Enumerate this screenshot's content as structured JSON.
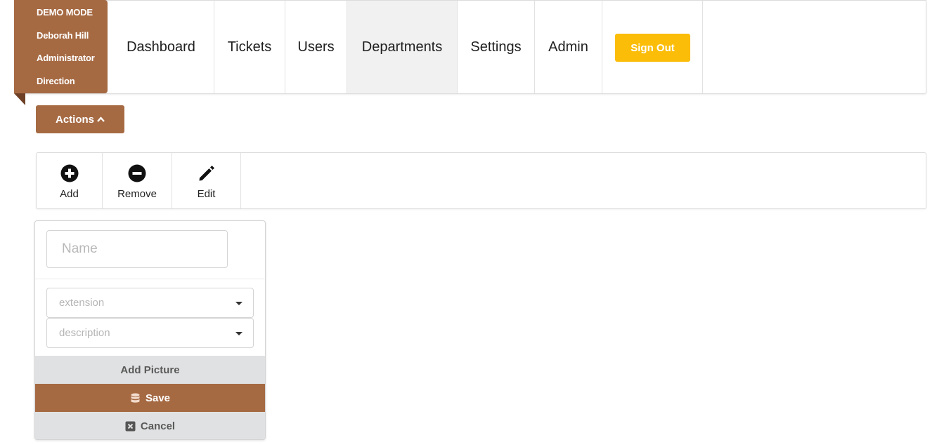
{
  "user": {
    "mode": "DEMO MODE",
    "name": "Deborah Hill",
    "role": "Administrator",
    "department": "Direction"
  },
  "nav": {
    "items": [
      {
        "label": "Dashboard"
      },
      {
        "label": "Tickets"
      },
      {
        "label": "Users"
      },
      {
        "label": "Departments",
        "active": true
      },
      {
        "label": "Settings"
      },
      {
        "label": "Admin"
      }
    ],
    "sign_out": "Sign Out"
  },
  "actions": {
    "label": "Actions",
    "icon": "chevron-up-icon"
  },
  "toolbar": {
    "items": [
      {
        "label": "Add",
        "icon": "plus-circle-icon"
      },
      {
        "label": "Remove",
        "icon": "minus-circle-icon"
      },
      {
        "label": "Edit",
        "icon": "pencil-icon"
      }
    ]
  },
  "form": {
    "name_placeholder": "Name",
    "extension_placeholder": "extension",
    "description_placeholder": "description",
    "add_picture": "Add Picture",
    "save": "Save",
    "cancel": "Cancel"
  },
  "colors": {
    "brand": "#a66a43",
    "sign_out": "#fbbd08",
    "active_nav": "#f1f1f1"
  }
}
